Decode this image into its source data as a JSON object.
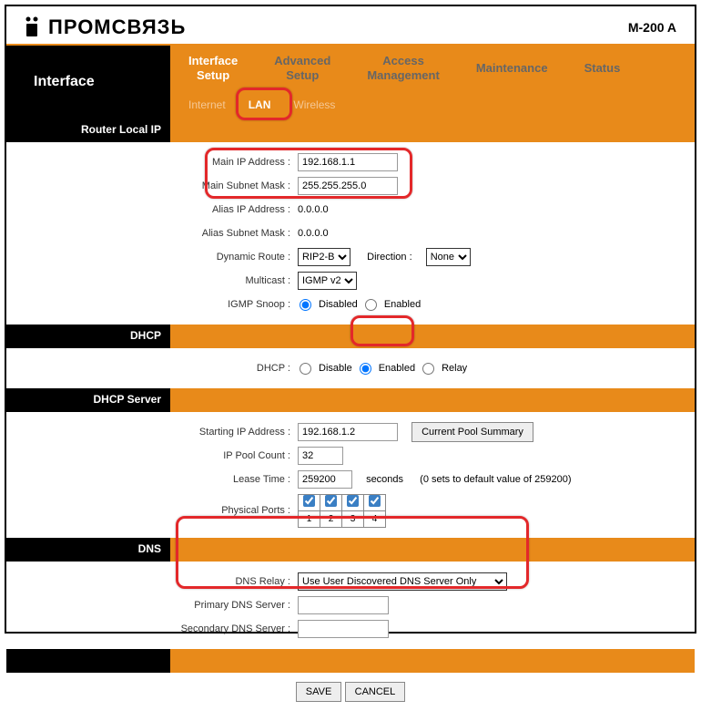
{
  "logo_text": "ПРОМСВЯЗЬ",
  "model": "M-200 A",
  "nav_title": "Interface",
  "tabs": {
    "t0": "Interface\nSetup",
    "t1": "Advanced\nSetup",
    "t2": "Access\nManagement",
    "t3": "Maintenance",
    "t4": "Status"
  },
  "subtabs": {
    "s0": "Internet",
    "s1": "LAN",
    "s2": "Wireless"
  },
  "sections": {
    "router": "Router Local IP",
    "dhcp": "DHCP",
    "dhcp_server": "DHCP Server",
    "dns": "DNS"
  },
  "labels": {
    "main_ip": "Main IP Address :",
    "main_mask": "Main Subnet Mask :",
    "alias_ip": "Alias IP Address :",
    "alias_mask": "Alias Subnet Mask :",
    "dyn_route": "Dynamic Route :",
    "direction": "Direction :",
    "multicast": "Multicast :",
    "igmp_snoop": "IGMP Snoop :",
    "dhcp": "DHCP :",
    "start_ip": "Starting IP Address :",
    "pool_count": "IP Pool Count :",
    "lease": "Lease Time :",
    "phys_ports": "Physical Ports :",
    "dns_relay": "DNS Relay :",
    "primary_dns": "Primary DNS Server :",
    "secondary_dns": "Secondary DNS Server :"
  },
  "values": {
    "main_ip": "192.168.1.1",
    "main_mask": "255.255.255.0",
    "alias_ip": "0.0.0.0",
    "alias_mask": "0.0.0.0",
    "dyn_route": "RIP2-B",
    "direction": "None",
    "multicast": "IGMP v2",
    "igmp_snoop": "disabled",
    "dhcp": "enabled",
    "start_ip": "192.168.1.2",
    "pool_count": "32",
    "lease": "259200",
    "dns_relay": "Use User Discovered DNS Server Only",
    "primary_dns": "",
    "secondary_dns": "",
    "ports": [
      "1",
      "2",
      "3",
      "4"
    ]
  },
  "text": {
    "disabled": "Disabled",
    "enabled": "Enabled",
    "disable": "Disable",
    "relay": "Relay",
    "seconds": "seconds",
    "lease_note": "(0 sets to default value of 259200)",
    "pool_summary": "Current Pool Summary",
    "save": "SAVE",
    "cancel": "CANCEL"
  }
}
